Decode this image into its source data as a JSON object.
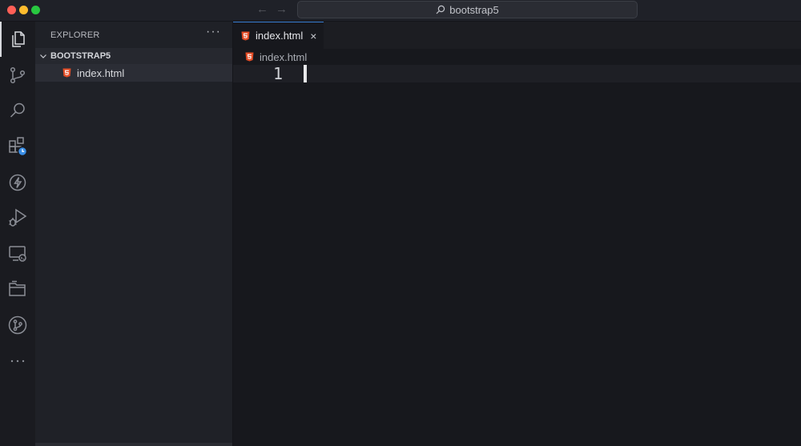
{
  "window": {
    "command_center_label": "bootstrap5",
    "nav_back_glyph": "←",
    "nav_forward_glyph": "→"
  },
  "activity_bar": {
    "items": [
      {
        "icon": "files-icon",
        "active": true
      },
      {
        "icon": "source-control-icon"
      },
      {
        "icon": "search-icon"
      },
      {
        "icon": "extensions-icon"
      },
      {
        "icon": "lightning-icon"
      },
      {
        "icon": "run-debug-icon"
      },
      {
        "icon": "remote-explorer-icon"
      },
      {
        "icon": "folder-icon"
      },
      {
        "icon": "git-graph-icon"
      },
      {
        "icon": "more-icon"
      }
    ]
  },
  "sidebar": {
    "title": "EXPLORER",
    "more_glyph": "···",
    "folder": {
      "name": "BOOTSTRAP5"
    },
    "files": [
      {
        "name": "index.html",
        "icon": "html5-icon"
      }
    ]
  },
  "editor": {
    "tab": {
      "label": "index.html",
      "close_glyph": "×"
    },
    "breadcrumb": {
      "label": "index.html"
    },
    "lines": [
      {
        "number": "1",
        "text": ""
      }
    ]
  },
  "colors": {
    "html_icon": "#e44d26",
    "tab_accent": "#3a7fd5",
    "badge_blue": "#3a8ee6"
  }
}
